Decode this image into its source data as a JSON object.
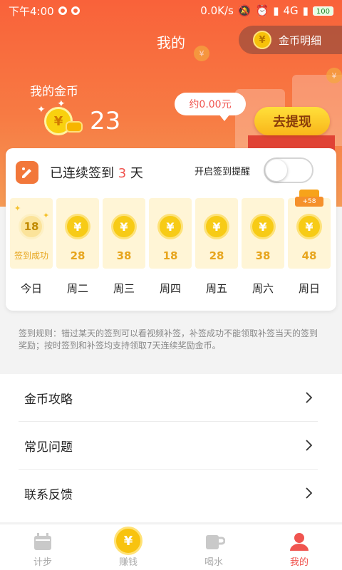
{
  "status_bar": {
    "time": "下午4:00",
    "speed": "0.0K/s",
    "network": "4G",
    "battery": "100"
  },
  "header": {
    "title": "我的",
    "coin_detail_label": "金币明细",
    "coin_glyph": "¥"
  },
  "wallet": {
    "label": "我的金币",
    "coins": "23",
    "approx_value": "约0.00元",
    "withdraw_label": "去提现"
  },
  "signin": {
    "streak_prefix": "已连续签到",
    "streak_days": "3",
    "streak_suffix": "天",
    "reminder_label": "开启签到提醒",
    "reminder_on": false,
    "days": [
      {
        "label": "今日",
        "coin_text": "18",
        "status": "签到成功",
        "value": "",
        "checked": true,
        "gift": ""
      },
      {
        "label": "周二",
        "coin_text": "¥",
        "status": "",
        "value": "28",
        "checked": false,
        "gift": ""
      },
      {
        "label": "周三",
        "coin_text": "¥",
        "status": "",
        "value": "38",
        "checked": false,
        "gift": ""
      },
      {
        "label": "周四",
        "coin_text": "¥",
        "status": "",
        "value": "18",
        "checked": false,
        "gift": ""
      },
      {
        "label": "周五",
        "coin_text": "¥",
        "status": "",
        "value": "28",
        "checked": false,
        "gift": ""
      },
      {
        "label": "周六",
        "coin_text": "¥",
        "status": "",
        "value": "38",
        "checked": false,
        "gift": ""
      },
      {
        "label": "周日",
        "coin_text": "¥",
        "status": "",
        "value": "48",
        "checked": false,
        "gift": "+58"
      }
    ]
  },
  "rules_text": "签到规则：错过某天的签到可以看视频补签，补签成功不能领取补签当天的签到奖励；按时签到和补签均支持领取7天连续奖励金币。",
  "menu": [
    {
      "label": "金币攻略",
      "icon": "chevron-right-icon"
    },
    {
      "label": "常见问题",
      "icon": "chevron-right-icon"
    },
    {
      "label": "联系反馈",
      "icon": "chevron-right-icon"
    }
  ],
  "tabs": [
    {
      "label": "计步",
      "icon": "calendar-icon",
      "active": false
    },
    {
      "label": "赚钱",
      "icon": "coin-icon",
      "active": false
    },
    {
      "label": "喝水",
      "icon": "cup-icon",
      "active": false
    },
    {
      "label": "我的",
      "icon": "user-icon",
      "active": true
    }
  ],
  "colors": {
    "accent": "#f0544f",
    "hero_top": "#f9623a",
    "hero_bottom": "#f59a55",
    "coin_gold": "#f7cb16",
    "day_card_bg": "#fff5d6"
  }
}
